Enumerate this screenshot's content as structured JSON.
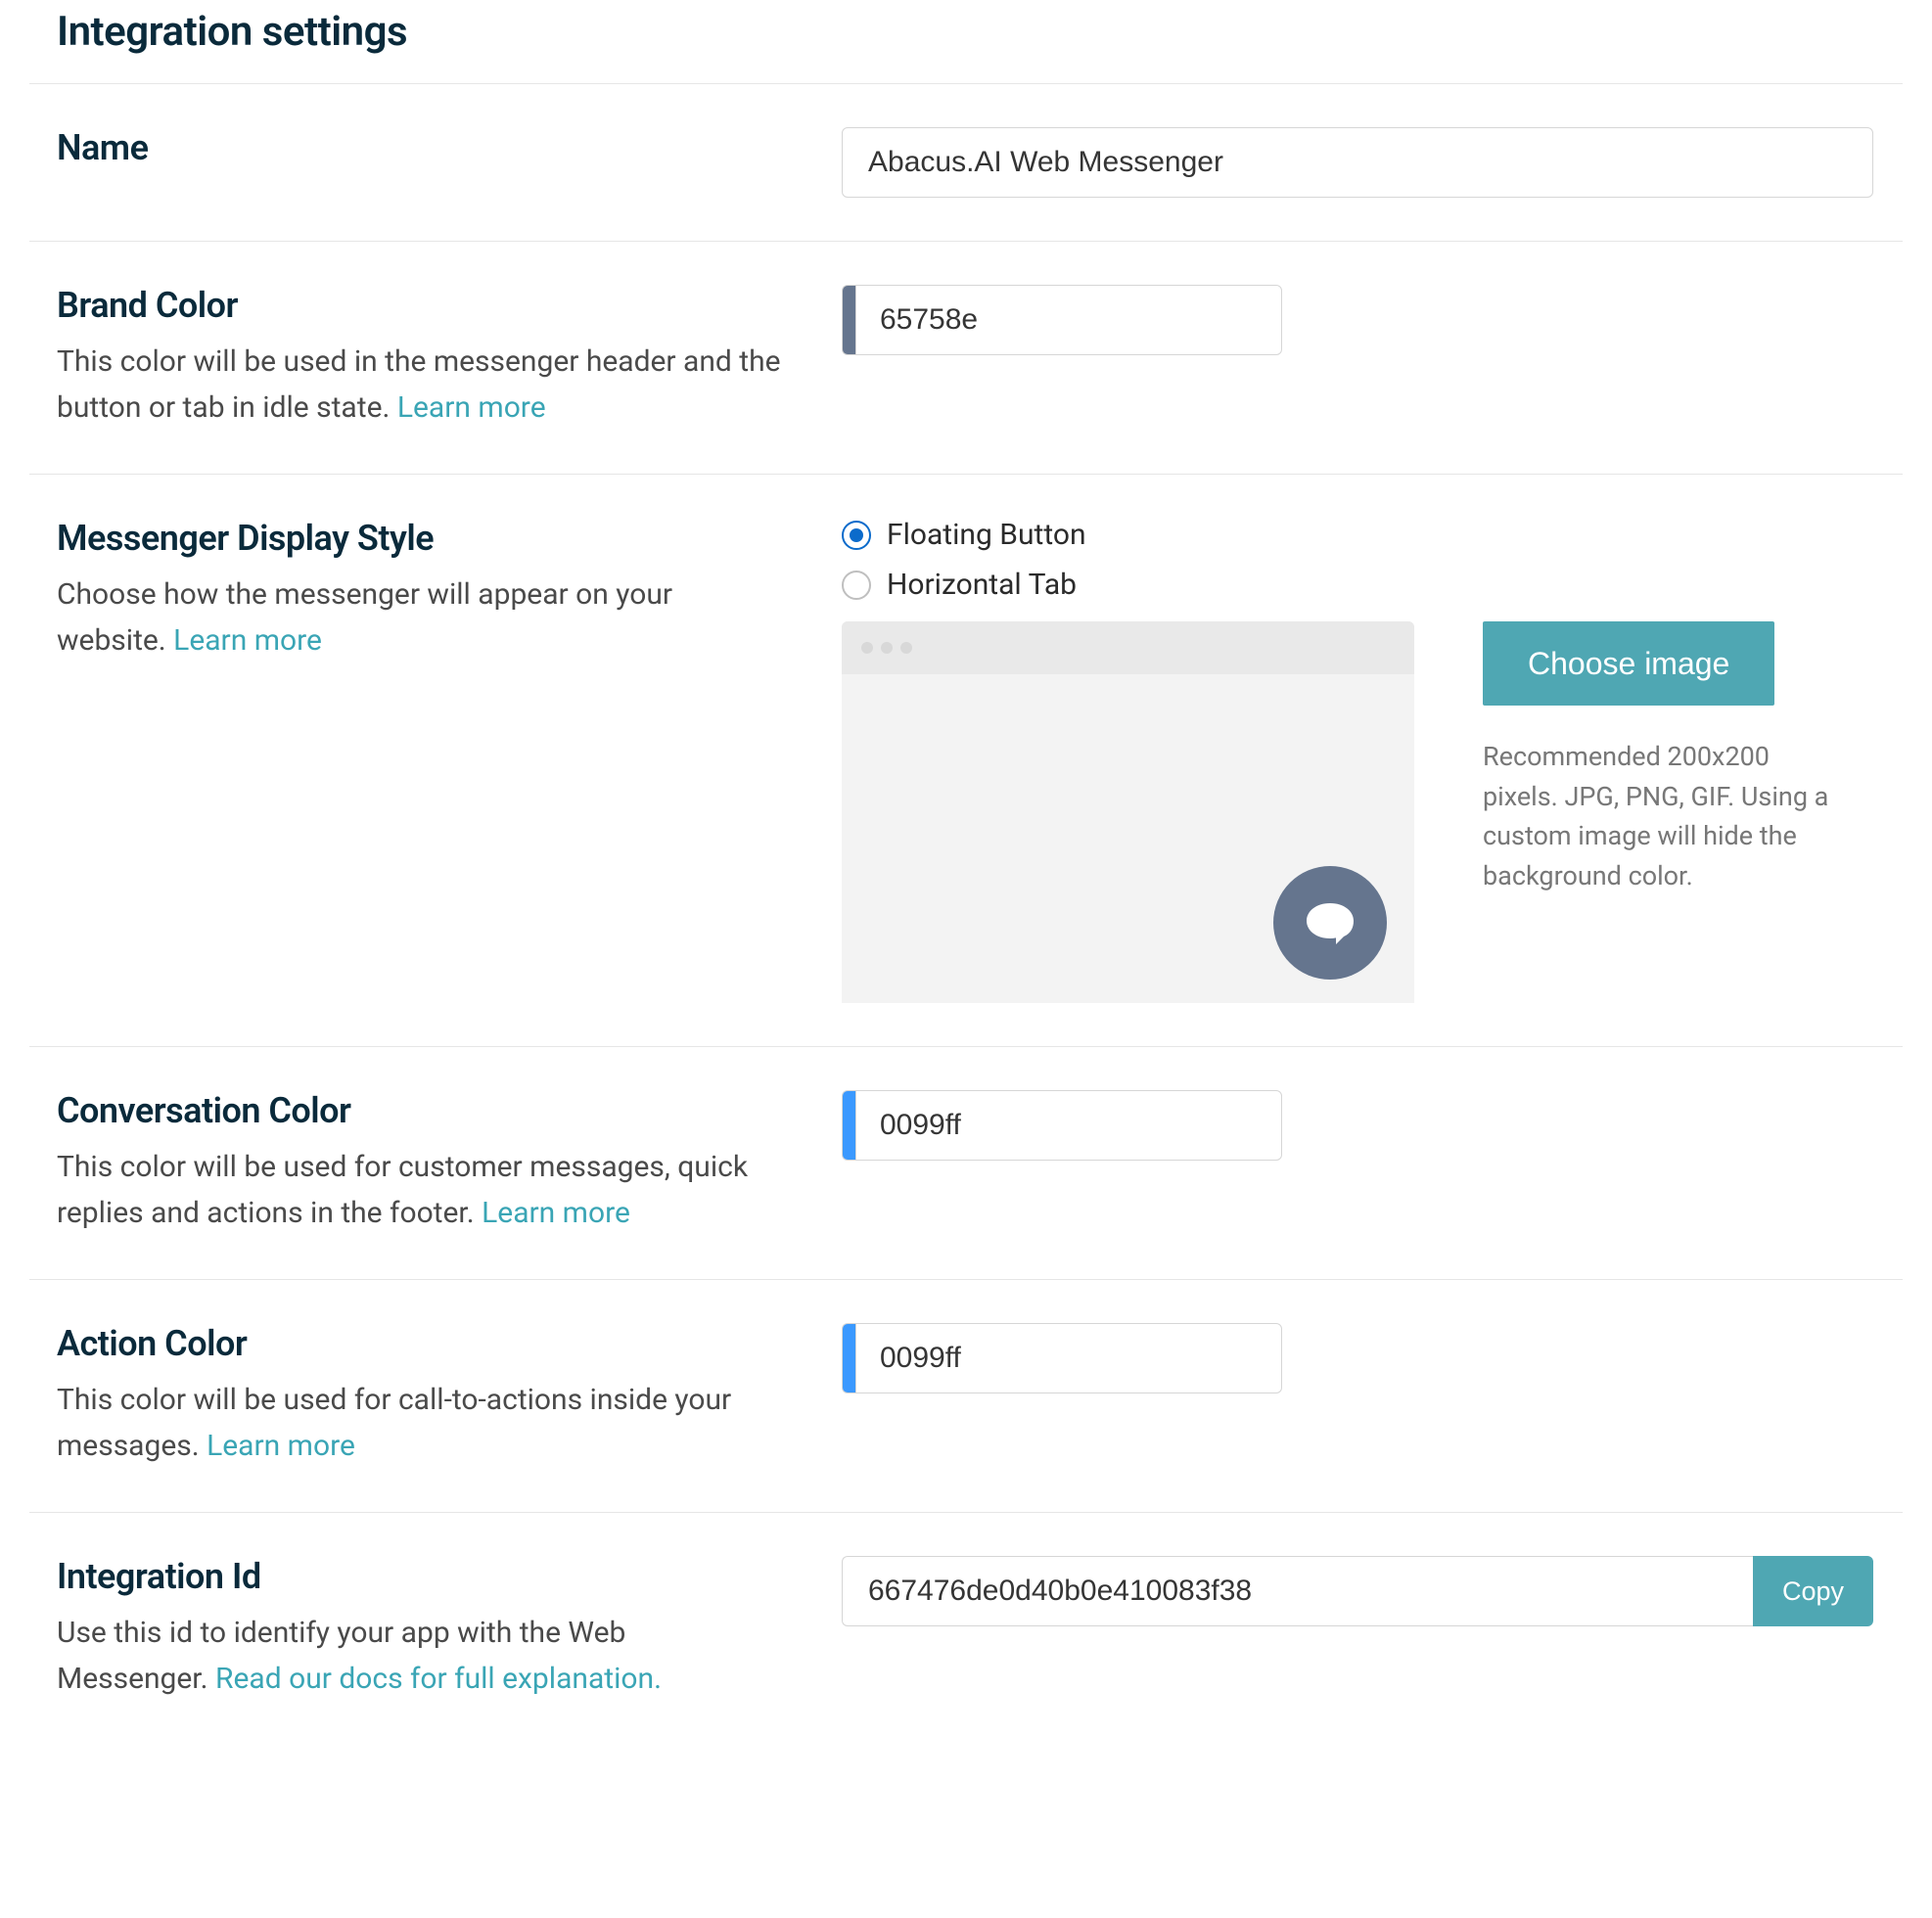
{
  "page": {
    "title": "Integration settings"
  },
  "name_field": {
    "label": "Name",
    "value": "Abacus.AI Web Messenger"
  },
  "brand_color": {
    "label": "Brand Color",
    "desc_before": "This color will be used in the messenger header and the button or tab in idle state. ",
    "learn_more": "Learn more",
    "value": "65758e",
    "swatch_hex": "#65758e"
  },
  "display_style": {
    "label": "Messenger Display Style",
    "desc_before": "Choose how the messenger will appear on your website. ",
    "learn_more": "Learn more",
    "options": [
      {
        "label": "Floating Button",
        "selected": true
      },
      {
        "label": "Horizontal Tab",
        "selected": false
      }
    ],
    "choose_image_label": "Choose image",
    "recommendation": "Recommended 200x200 pixels. JPG, PNG, GIF. Using a custom image will hide the background color.",
    "preview_button_color": "#65758e"
  },
  "conversation_color": {
    "label": "Conversation Color",
    "desc_before": "This color will be used for customer messages, quick replies and actions in the footer. ",
    "learn_more": "Learn more",
    "value": "0099ff",
    "swatch_hex": "#3b99ff"
  },
  "action_color": {
    "label": "Action Color",
    "desc_before": "This color will be used for call-to-actions inside your messages. ",
    "learn_more": "Learn more",
    "value": "0099ff",
    "swatch_hex": "#3b99ff"
  },
  "integration_id": {
    "label": "Integration Id",
    "desc_before": "Use this id to identify your app with the Web Messenger. ",
    "docs_link": "Read our docs for full explanation.",
    "value": "667476de0d40b0e410083f38",
    "copy_label": "Copy"
  }
}
